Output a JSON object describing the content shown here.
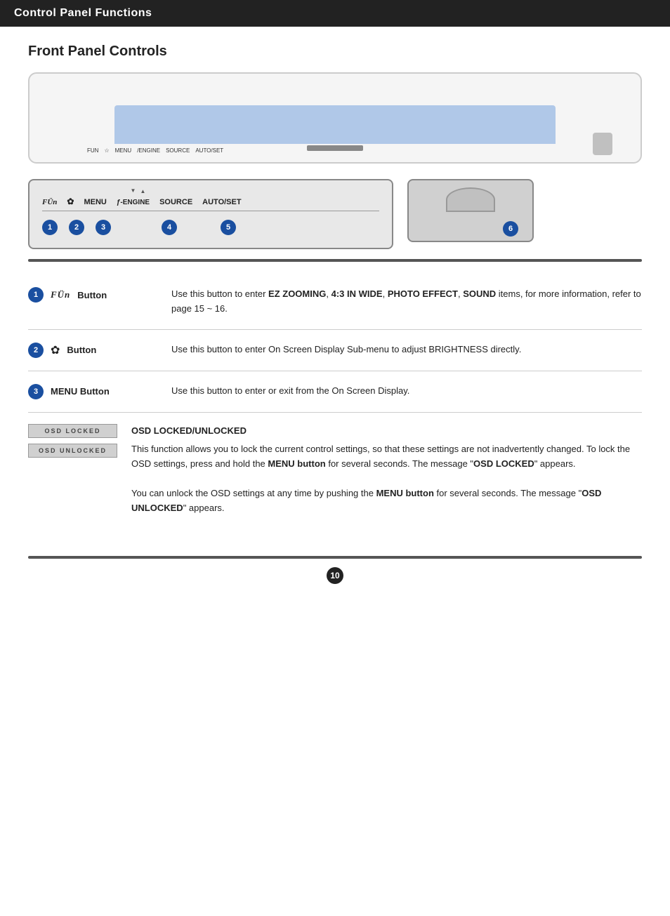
{
  "header": {
    "title": "Control Panel Functions"
  },
  "front_panel": {
    "section_title": "Front Panel Controls"
  },
  "buttons": {
    "labels_row": [
      "FUN",
      "☆",
      "MENU",
      "ƒ-ENGINE",
      "SOURCE",
      "AUTO/SET"
    ],
    "circle_numbers": [
      "1",
      "2",
      "3",
      "4",
      "5",
      "6"
    ]
  },
  "descriptions": [
    {
      "number": "1",
      "icon": "FÜn",
      "label": "Button",
      "desc_parts": [
        {
          "text": "Use this button to enter "
        },
        {
          "text": "EZ ZOOMING",
          "bold": true
        },
        {
          "text": ", "
        },
        {
          "text": "4:3 IN WIDE",
          "bold": true
        },
        {
          "text": ", "
        },
        {
          "text": "PHOTO EFFECT",
          "bold": true
        },
        {
          "text": ", "
        },
        {
          "text": "SOUND",
          "bold": true
        },
        {
          "text": " items, for more information, refer to page 15 ~ 16."
        }
      ]
    },
    {
      "number": "2",
      "icon": "☆",
      "label": "Button",
      "desc": "Use this button to enter On Screen Display Sub-menu to adjust BRIGHTNESS directly."
    },
    {
      "number": "3",
      "icon": "",
      "label": "MENU Button",
      "desc": "Use this button to enter or exit from the On Screen Display."
    }
  ],
  "osd_section": {
    "title": "OSD LOCKED/UNLOCKED",
    "badge_locked": "OSD LOCKED",
    "badge_unlocked": "OSD UNLOCKED",
    "text1": "This function allows you to lock the current control settings, so that these settings are not inadvertently changed. To lock the OSD settings, press and hold the ",
    "text1_bold": "MENU button",
    "text1_end": " for several seconds. The message \"",
    "text1_msg": "OSD LOCKED",
    "text1_end2": "\" appears.",
    "text2": "You can unlock the OSD settings at any time by pushing the ",
    "text2_bold": "MENU button",
    "text2_end": " for several seconds. The message \"",
    "text2_msg": "OSD UNLOCKED",
    "text2_end2": "\" appears."
  },
  "page_number": "10"
}
